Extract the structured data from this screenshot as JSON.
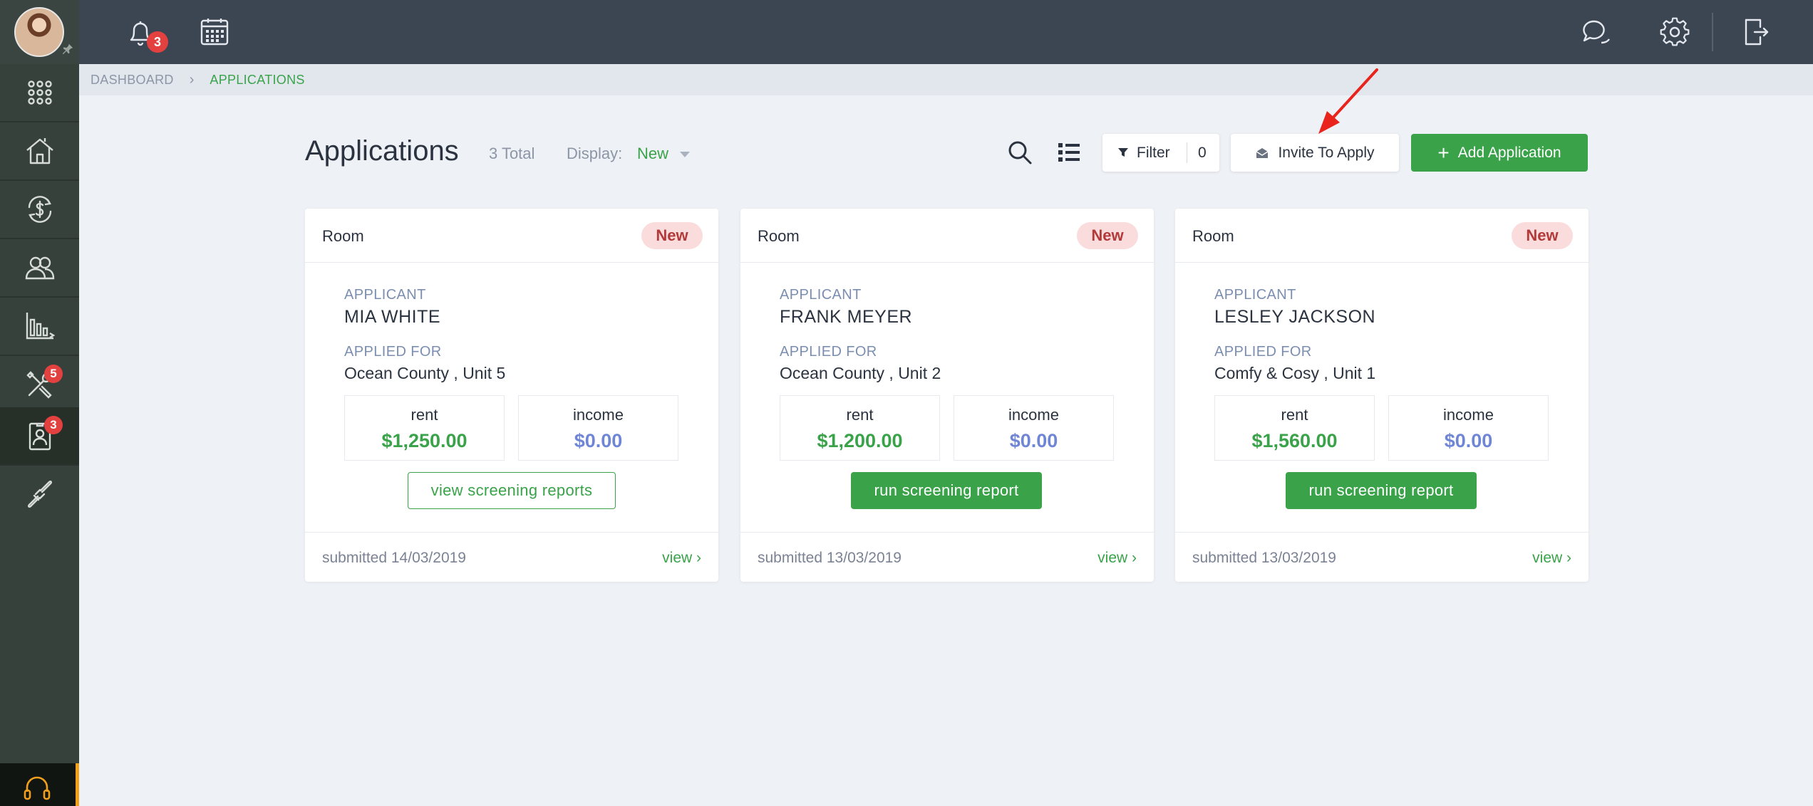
{
  "sidebar": {
    "badges": {
      "maintenance": "5",
      "applications": "3"
    },
    "items": [
      "apps-grid-icon",
      "property-icon",
      "payments-icon",
      "tenants-icon",
      "reports-icon",
      "maintenance-icon",
      "applications-icon",
      "integrations-icon"
    ]
  },
  "topbar": {
    "notifications_count": "3"
  },
  "breadcrumb": {
    "root": "DASHBOARD",
    "current": "APPLICATIONS"
  },
  "header": {
    "title": "Applications",
    "total": "3 Total",
    "display_label": "Display:",
    "display_value": "New",
    "filter_label": "Filter",
    "filter_count": "0",
    "invite_label": "Invite To Apply",
    "add_label": "Add Application"
  },
  "cards": [
    {
      "type": "Room",
      "status": "New",
      "applicant_label": "APPLICANT",
      "applicant_name": "MIA WHITE",
      "applied_for_label": "APPLIED FOR",
      "applied_for": "Ocean County , Unit 5",
      "rent_label": "rent",
      "rent": "$1,250.00",
      "income_label": "income",
      "income": "$0.00",
      "action": "view screening reports",
      "submitted": "submitted 14/03/2019",
      "view": "view ›"
    },
    {
      "type": "Room",
      "status": "New",
      "applicant_label": "APPLICANT",
      "applicant_name": "FRANK MEYER",
      "applied_for_label": "APPLIED FOR",
      "applied_for": "Ocean County , Unit 2",
      "rent_label": "rent",
      "rent": "$1,200.00",
      "income_label": "income",
      "income": "$0.00",
      "action": "run screening report",
      "submitted": "submitted 13/03/2019",
      "view": "view ›"
    },
    {
      "type": "Room",
      "status": "New",
      "applicant_label": "APPLICANT",
      "applicant_name": "LESLEY JACKSON",
      "applied_for_label": "APPLIED FOR",
      "applied_for": "Comfy & Cosy , Unit 1",
      "rent_label": "rent",
      "rent": "$1,560.00",
      "income_label": "income",
      "income": "$0.00",
      "action": "run screening report",
      "submitted": "submitted 13/03/2019",
      "view": "view ›"
    }
  ],
  "colors": {
    "accent": "#3aa34a",
    "badge_red": "#e2413f",
    "income_blue": "#6f86d6",
    "annotation_arrow": "#e8241c"
  }
}
